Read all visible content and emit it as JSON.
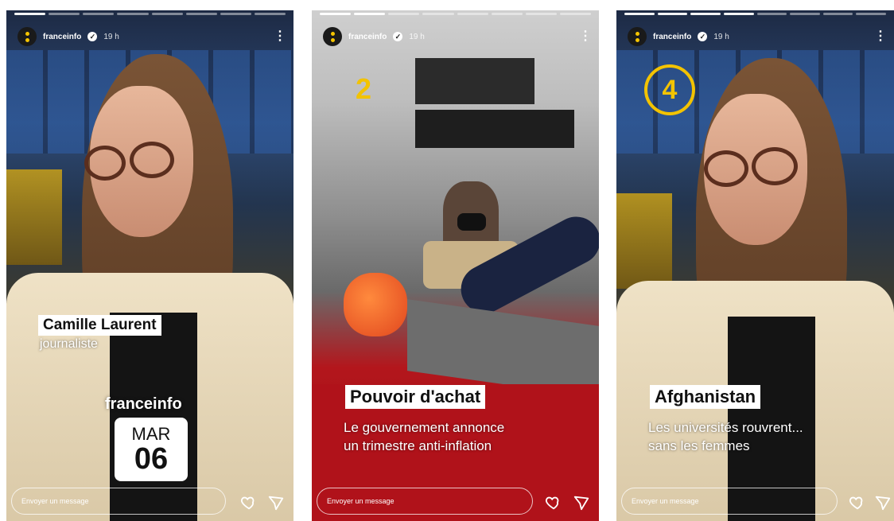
{
  "stories": [
    {
      "account": "franceinfo",
      "time": "19 h",
      "lower_third": {
        "name": "Camille Laurent",
        "role": "journaliste"
      },
      "brand": "franceinfo",
      "date": {
        "day_of_week": "MAR",
        "day": "06"
      },
      "reply_placeholder": "Envoyer un message"
    },
    {
      "account": "franceinfo",
      "time": "19 h",
      "number_badge": "2",
      "headline": "Pouvoir d'achat",
      "subline_1": "Le gouvernement annonce",
      "subline_2": "un trimestre anti-inflation",
      "reply_placeholder": "Envoyer un message"
    },
    {
      "account": "franceinfo",
      "time": "19 h",
      "number_badge": "4",
      "headline": "Afghanistan",
      "subline_1": "Les universités rouvrent...",
      "subline_2": "sans les femmes",
      "reply_placeholder": "Envoyer un message"
    }
  ],
  "icons": {
    "like": "heart-icon",
    "share": "send-icon",
    "menu": "more-options-icon",
    "verified": "verified-badge-icon"
  },
  "colors": {
    "brand_yellow": "#f3c300",
    "story_accent": "#b0121a"
  }
}
